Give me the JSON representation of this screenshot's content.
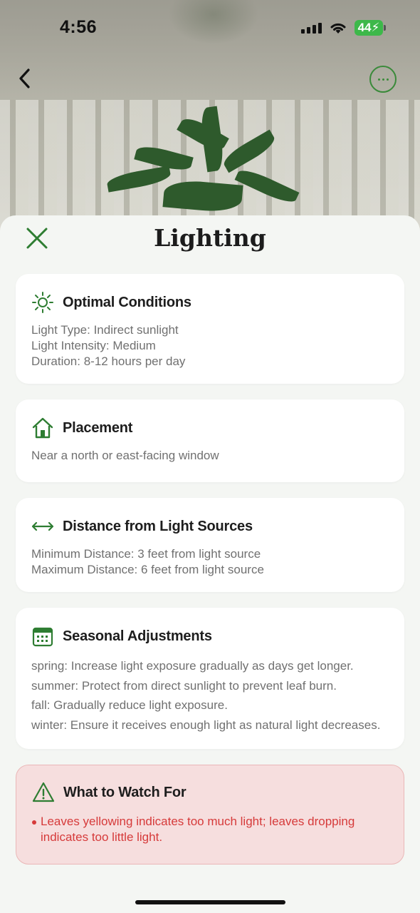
{
  "status_bar": {
    "time": "4:56",
    "battery": "44"
  },
  "sheet": {
    "title": "Lighting"
  },
  "cards": {
    "optimal": {
      "title": "Optimal Conditions",
      "lines": [
        "Light Type: Indirect sunlight",
        "Light Intensity: Medium",
        "Duration: 8-12 hours per day"
      ]
    },
    "placement": {
      "title": "Placement",
      "lines": [
        "Near a north or east-facing window"
      ]
    },
    "distance": {
      "title": "Distance from Light Sources",
      "lines": [
        "Minimum Distance: 3 feet from light source",
        "Maximum Distance: 6 feet from light source"
      ]
    },
    "seasonal": {
      "title": "Seasonal Adjustments",
      "lines": [
        "spring: Increase light exposure gradually as days get longer.",
        "summer: Protect from direct sunlight to prevent leaf burn.",
        "fall: Gradually reduce light exposure.",
        "winter: Ensure it receives enough light as natural light decreases."
      ]
    },
    "watch": {
      "title": "What to Watch For",
      "items": [
        "Leaves yellowing indicates too much light; leaves dropping indicates too little light."
      ]
    }
  },
  "icons": {
    "optimal": "sun-icon",
    "placement": "home-icon",
    "distance": "horizontal-arrows-icon",
    "seasonal": "calendar-icon",
    "watch": "warning-triangle-icon"
  },
  "colors": {
    "accent": "#2e7d32",
    "warning_text": "#d63a3a",
    "warning_bg": "#f6dede"
  }
}
